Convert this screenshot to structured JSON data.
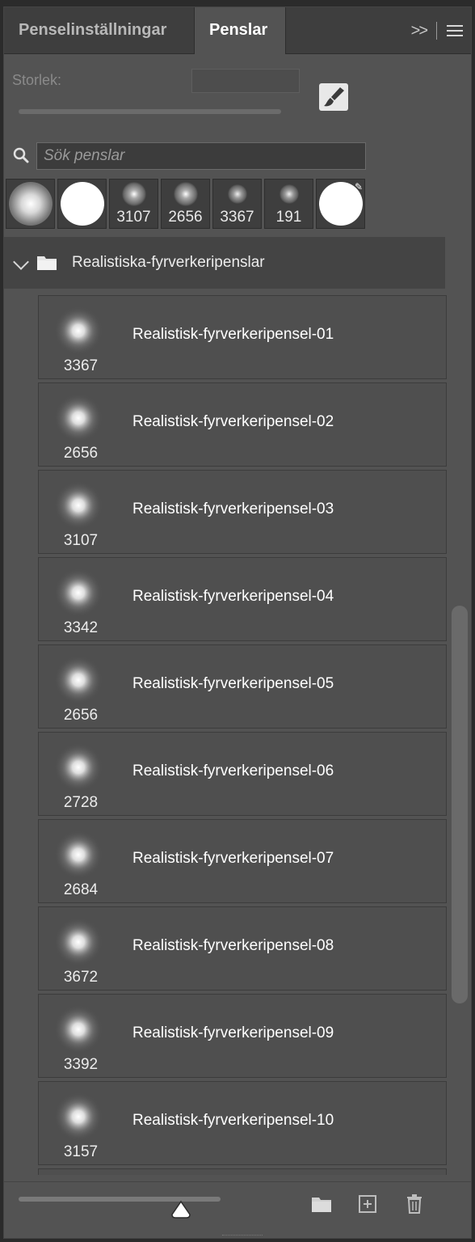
{
  "tabs": [
    {
      "label": "Penselinställningar",
      "active": false
    },
    {
      "label": "Penslar",
      "active": true
    }
  ],
  "tab_tools": {
    "expand_glyph": ">>"
  },
  "size": {
    "label": "Storlek:",
    "value": ""
  },
  "search": {
    "placeholder": "Sök penslar",
    "value": ""
  },
  "recent_brushes": [
    {
      "kind": "soft-round",
      "size": ""
    },
    {
      "kind": "hard-round",
      "size": ""
    },
    {
      "kind": "firework",
      "size": "3107"
    },
    {
      "kind": "firework",
      "size": "2656"
    },
    {
      "kind": "firework",
      "size": "3367"
    },
    {
      "kind": "firework",
      "size": "191"
    },
    {
      "kind": "hard-round-eraser",
      "size": ""
    }
  ],
  "group": {
    "name": "Realistiska-fyrverkeripenslar",
    "expanded": true
  },
  "brushes": [
    {
      "name": "Realistisk-fyrverkeripensel-01",
      "size": "3367"
    },
    {
      "name": "Realistisk-fyrverkeripensel-02",
      "size": "2656"
    },
    {
      "name": "Realistisk-fyrverkeripensel-03",
      "size": "3107"
    },
    {
      "name": "Realistisk-fyrverkeripensel-04",
      "size": "3342"
    },
    {
      "name": "Realistisk-fyrverkeripensel-05",
      "size": "2656"
    },
    {
      "name": "Realistisk-fyrverkeripensel-06",
      "size": "2728"
    },
    {
      "name": "Realistisk-fyrverkeripensel-07",
      "size": "2684"
    },
    {
      "name": "Realistisk-fyrverkeripensel-08",
      "size": "3672"
    },
    {
      "name": "Realistisk-fyrverkeripensel-09",
      "size": "3392"
    },
    {
      "name": "Realistisk-fyrverkeripensel-10",
      "size": "3157"
    }
  ],
  "icons": {
    "search": "search-icon",
    "brush_tool": "brush-icon",
    "panel_menu": "menu-icon",
    "new_group": "folder-icon",
    "new_brush": "add-icon",
    "delete": "trash-icon"
  },
  "colors": {
    "panel": "#535353",
    "tabbar": "#3e3e3e",
    "group": "#444444",
    "item": "#4f4f4f"
  }
}
